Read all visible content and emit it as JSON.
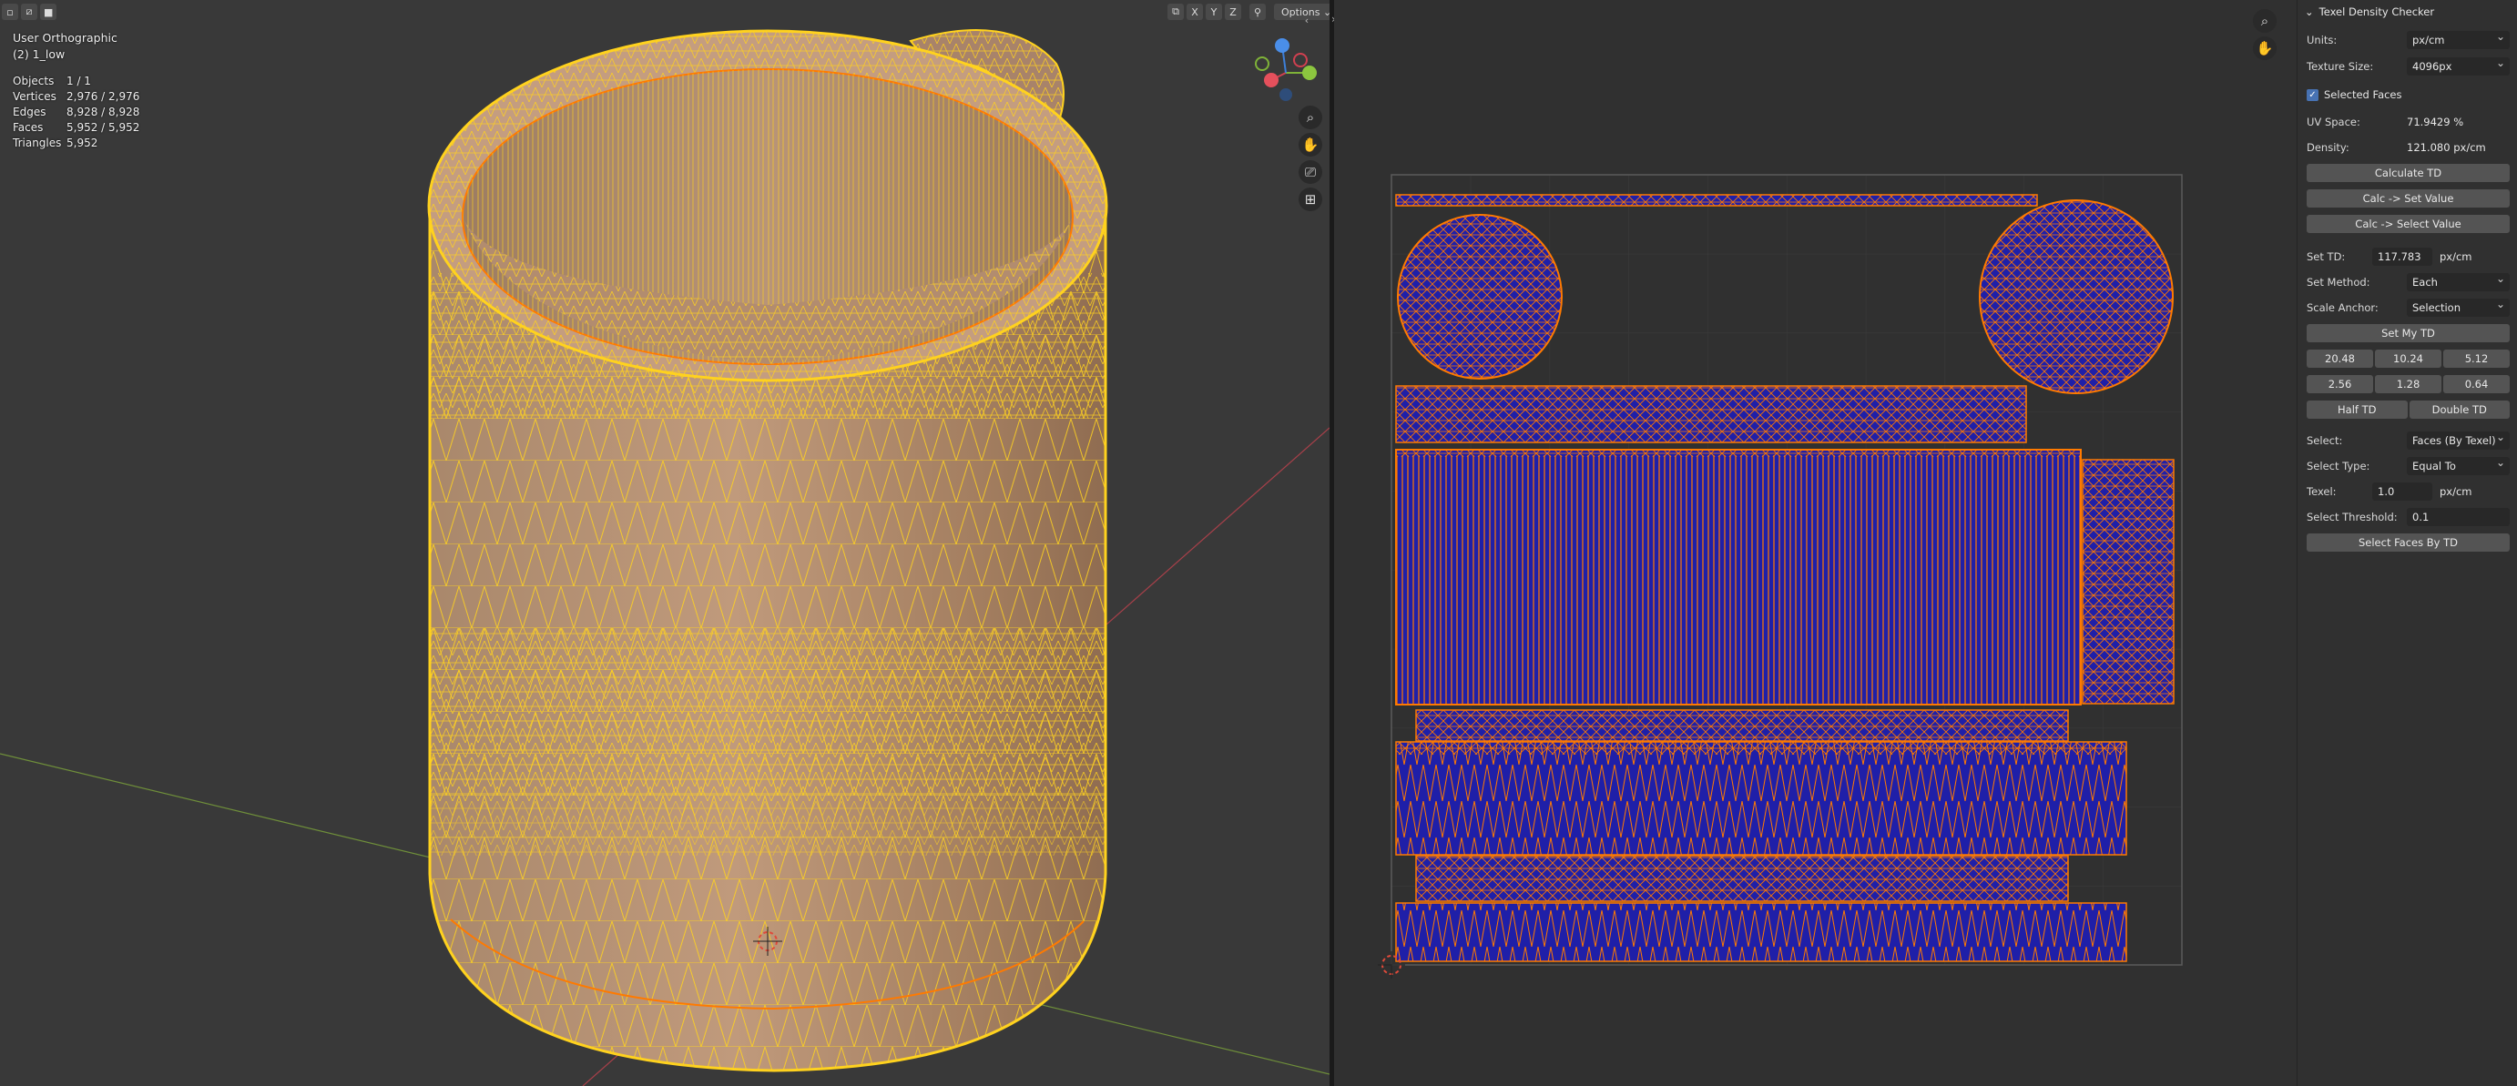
{
  "viewport": {
    "view_name": "User Orthographic",
    "object_name": "(2) 1_low",
    "stats": [
      {
        "label": "Objects",
        "value": "1 / 1"
      },
      {
        "label": "Vertices",
        "value": "2,976 / 2,976"
      },
      {
        "label": "Edges",
        "value": "8,928 / 8,928"
      },
      {
        "label": "Faces",
        "value": "5,952 / 5,952"
      },
      {
        "label": "Triangles",
        "value": "5,952"
      }
    ],
    "header_axes": [
      "X",
      "Y",
      "Z"
    ],
    "options_label": "Options",
    "gizmo_axes": {
      "x": "X",
      "y": "Y",
      "z": "Z"
    },
    "colors": {
      "wire": "#ffd21e",
      "mesh": "#b08a6c",
      "accent": "#ff7a00"
    }
  },
  "panel": {
    "title": "Texel Density Checker",
    "units_label": "Units:",
    "units_value": "px/cm",
    "texture_size_label": "Texture Size:",
    "texture_size_value": "4096px",
    "selected_faces_label": "Selected Faces",
    "uv_space_label": "UV Space:",
    "uv_space_value": "71.9429 %",
    "density_label": "Density:",
    "density_value": "121.080 px/cm",
    "calculate_td": "Calculate TD",
    "calc_set_value": "Calc -> Set Value",
    "calc_select_value": "Calc -> Select Value",
    "set_td_label": "Set TD:",
    "set_td_value": "117.783",
    "set_td_unit": "px/cm",
    "set_method_label": "Set Method:",
    "set_method_value": "Each",
    "scale_anchor_label": "Scale Anchor:",
    "scale_anchor_value": "Selection",
    "set_my_td": "Set My TD",
    "presets_row1": [
      "20.48",
      "10.24",
      "5.12"
    ],
    "presets_row2": [
      "2.56",
      "1.28",
      "0.64"
    ],
    "half_td": "Half TD",
    "double_td": "Double TD",
    "select_label": "Select:",
    "select_value": "Faces (By Texel)",
    "select_type_label": "Select Type:",
    "select_type_value": "Equal To",
    "texel_label": "Texel:",
    "texel_value": "1.0",
    "texel_unit": "px/cm",
    "threshold_label": "Select Threshold:",
    "threshold_value": "0.1",
    "select_faces_by_td": "Select Faces By TD"
  },
  "uv": {
    "colors": {
      "island_fill": "#1f1fa8",
      "edge": "#ff7a00",
      "grid": "#3a3a3a",
      "bounds": "#5a5a5a"
    }
  }
}
